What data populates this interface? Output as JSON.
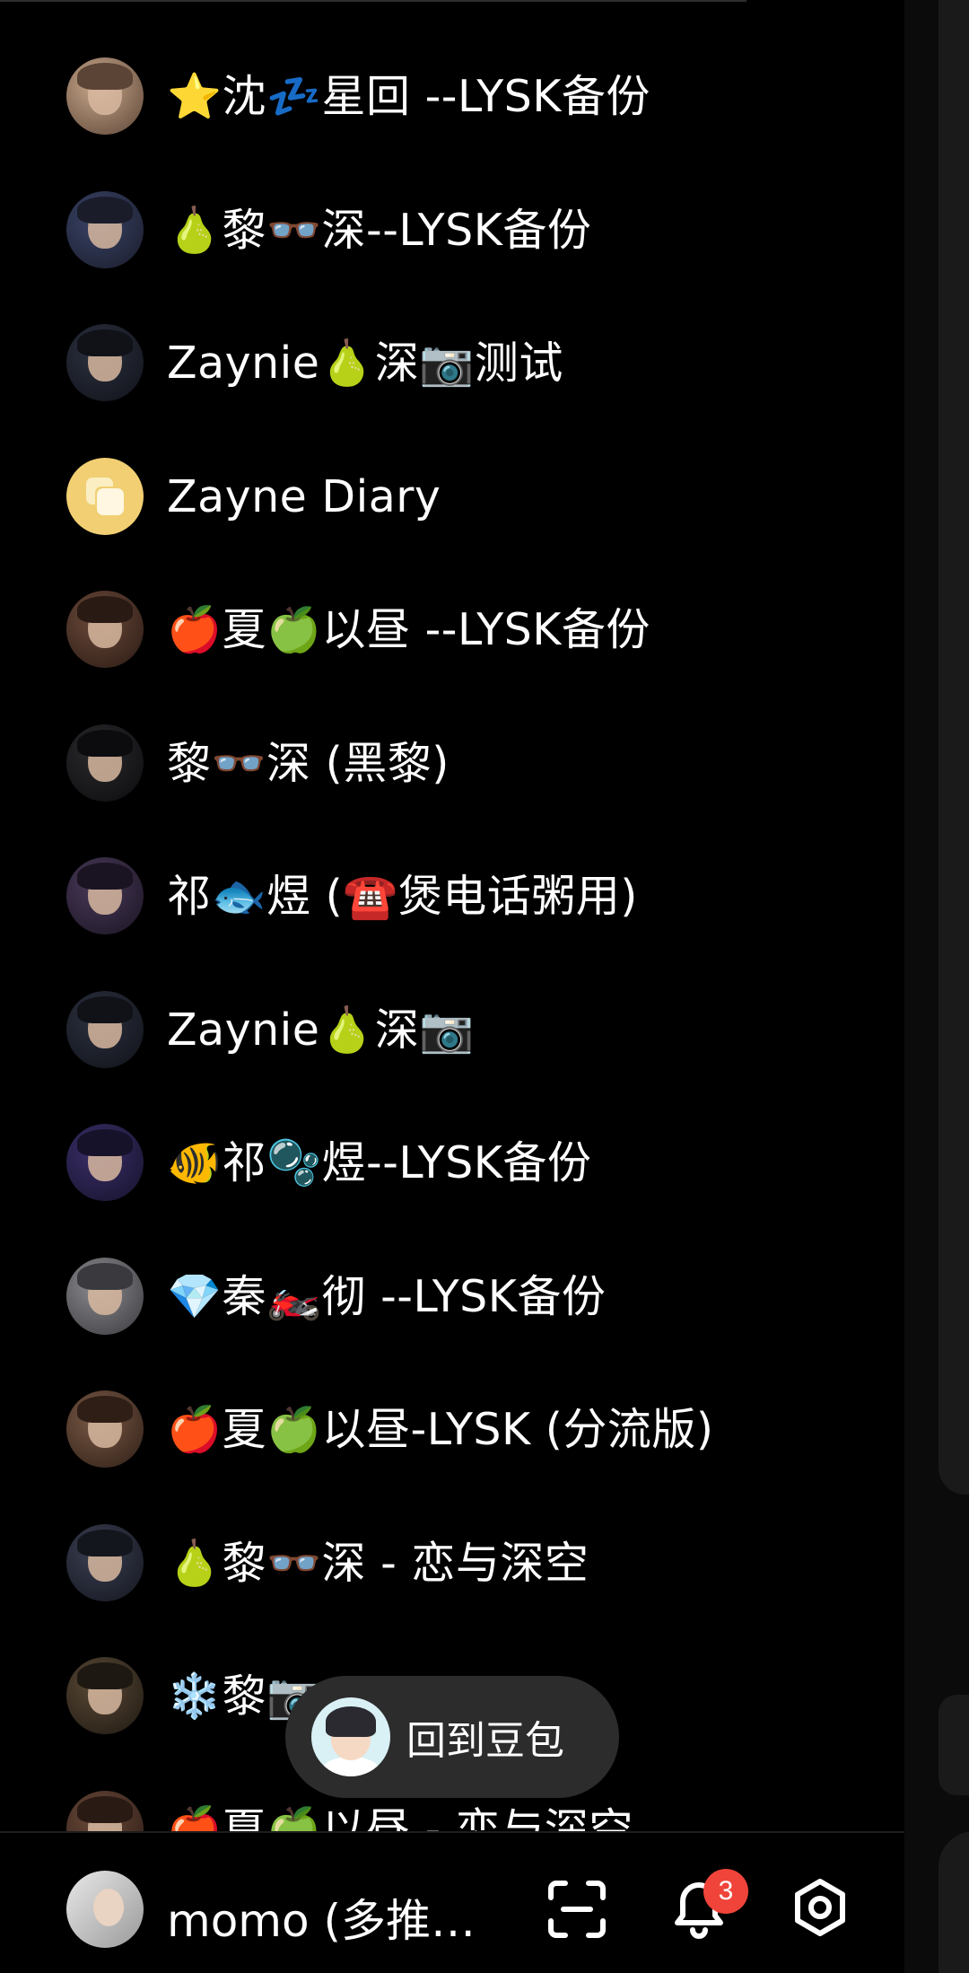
{
  "chat_list": [
    {
      "name": "⭐沈💤星回 --LYSK备份",
      "avatar": "avatar-portrait",
      "avatar_colors": [
        "#caa98c",
        "#5b4436"
      ]
    },
    {
      "name": "🍐黎👓深--LYSK备份",
      "avatar": "avatar-portrait",
      "avatar_colors": [
        "#3a4468",
        "#1a1c2a"
      ]
    },
    {
      "name": "Zaynie🍐深📷测试",
      "avatar": "avatar-portrait",
      "avatar_colors": [
        "#2c3140",
        "#101218"
      ]
    },
    {
      "name": "Zayne Diary",
      "avatar": "diary-icon",
      "avatar_colors": [
        "#f1cf72",
        "#fbeec3"
      ]
    },
    {
      "name": "🍎夏🍏以昼 --LYSK备份",
      "avatar": "avatar-portrait",
      "avatar_colors": [
        "#6b4a3a",
        "#2a1a14"
      ]
    },
    {
      "name": "黎👓深 (黑黎)",
      "avatar": "avatar-portrait",
      "avatar_colors": [
        "#2a2a2e",
        "#0c0c0e"
      ]
    },
    {
      "name": "祁🐟煜 (☎️煲电话粥用)",
      "avatar": "avatar-portrait",
      "avatar_colors": [
        "#4a3a5a",
        "#1a1422"
      ]
    },
    {
      "name": "Zaynie🍐深📷",
      "avatar": "avatar-portrait",
      "avatar_colors": [
        "#2c3140",
        "#101218"
      ]
    },
    {
      "name": "🐠祁🫧煜--LYSK备份",
      "avatar": "avatar-portrait",
      "avatar_colors": [
        "#3b2f6a",
        "#15122a"
      ]
    },
    {
      "name": "💎秦🏍️彻 --LYSK备份",
      "avatar": "avatar-portrait",
      "avatar_colors": [
        "#8c8c90",
        "#3a3a3e"
      ]
    },
    {
      "name": "🍎夏🍏以昼-LYSK (分流版)",
      "avatar": "avatar-portrait",
      "avatar_colors": [
        "#7a5a46",
        "#2e1e16"
      ]
    },
    {
      "name": "🍐黎👓深 - 恋与深空",
      "avatar": "avatar-portrait",
      "avatar_colors": [
        "#3a3f52",
        "#14161e"
      ]
    },
    {
      "name": "❄️黎📷",
      "avatar": "avatar-portrait",
      "avatar_colors": [
        "#5a4a36",
        "#1e1812"
      ]
    },
    {
      "name": "🍎夏🍏以昼 - 恋与深空",
      "avatar": "avatar-portrait",
      "avatar_colors": [
        "#6b4a3a",
        "#2a1a14"
      ]
    }
  ],
  "back_button": {
    "label": "回到豆包"
  },
  "bottom_bar": {
    "user_name": "momo (多推…",
    "notification_count": "3",
    "icons": [
      "scan-icon",
      "bell-icon",
      "gear-icon"
    ]
  },
  "colors": {
    "background": "#000000",
    "pill": "#2c2c2c",
    "badge": "#f0443a",
    "diary_icon": "#f1cf72"
  }
}
